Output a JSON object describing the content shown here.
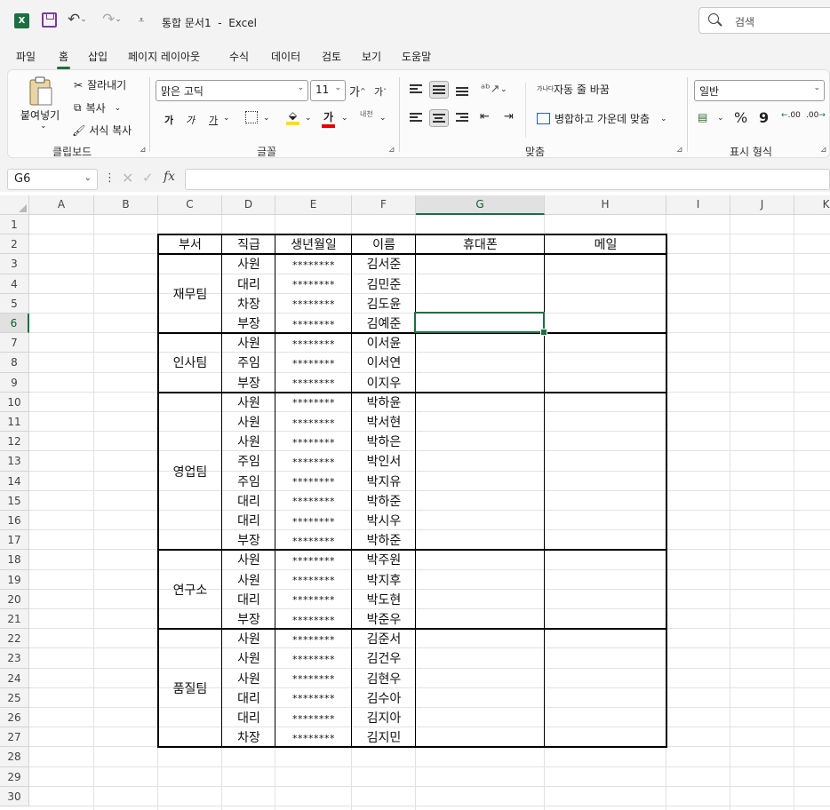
{
  "window": {
    "title": "통합 문서1  -  Excel",
    "app_icon": "X",
    "search_placeholder": "검색"
  },
  "menu": [
    "파일",
    "홈",
    "삽입",
    "페이지 레이아웃",
    "수식",
    "데이터",
    "검토",
    "보기",
    "도움말"
  ],
  "active_menu": "홈",
  "ribbon": {
    "clipboard": {
      "paste": "붙여넣기",
      "cut": "잘라내기",
      "copy": "복사",
      "format_painter": "서식 복사",
      "group": "클립보드"
    },
    "font": {
      "name": "맑은 고딕",
      "size": "11",
      "grow": "가",
      "shrink": "가",
      "bold": "가",
      "italic": "가",
      "underline": "가",
      "font_color_glyph": "가",
      "phonetic": "내천",
      "group": "글꼴"
    },
    "alignment": {
      "wrap_text": "자동 줄 바꿈",
      "merge_center": "병합하고 가운데 맞춤",
      "wrap_icon_text": "가나다",
      "group": "맞춤"
    },
    "number": {
      "format": "일반",
      "percent": "%",
      "comma": "9",
      "increase_decimal": ".00",
      "decrease_decimal": ".00",
      "group": "표시 형식"
    }
  },
  "formula_bar": {
    "name_box": "G6",
    "fx": "fx",
    "value": ""
  },
  "columns": [
    "A",
    "B",
    "C",
    "D",
    "E",
    "F",
    "G",
    "H",
    "I",
    "J",
    "K"
  ],
  "rows": [
    "1",
    "2",
    "3",
    "4",
    "5",
    "6",
    "7",
    "8",
    "9",
    "10",
    "11",
    "12",
    "13",
    "14",
    "15",
    "16",
    "17",
    "18",
    "19",
    "20",
    "21",
    "22",
    "23",
    "24",
    "25",
    "26",
    "27",
    "28",
    "29",
    "30"
  ],
  "selected_cell": {
    "column": "G",
    "row": "6"
  },
  "table": {
    "headers": [
      "부서",
      "직급",
      "생년월일",
      "이름",
      "휴대폰",
      "메일"
    ],
    "departments": [
      {
        "name": "재무팀",
        "rows": [
          [
            "사원",
            "********",
            "김서준"
          ],
          [
            "대리",
            "********",
            "김민준"
          ],
          [
            "차장",
            "********",
            "김도윤"
          ],
          [
            "부장",
            "********",
            "김예준"
          ]
        ]
      },
      {
        "name": "인사팀",
        "rows": [
          [
            "사원",
            "********",
            "이서윤"
          ],
          [
            "주임",
            "********",
            "이서연"
          ],
          [
            "부장",
            "********",
            "이지우"
          ]
        ]
      },
      {
        "name": "영업팀",
        "rows": [
          [
            "사원",
            "********",
            "박하윤"
          ],
          [
            "사원",
            "********",
            "박서현"
          ],
          [
            "사원",
            "********",
            "박하은"
          ],
          [
            "주임",
            "********",
            "박인서"
          ],
          [
            "주임",
            "********",
            "박지유"
          ],
          [
            "대리",
            "********",
            "박하준"
          ],
          [
            "대리",
            "********",
            "박시우"
          ],
          [
            "부장",
            "********",
            "박하준"
          ]
        ]
      },
      {
        "name": "연구소",
        "rows": [
          [
            "사원",
            "********",
            "박주원"
          ],
          [
            "사원",
            "********",
            "박지후"
          ],
          [
            "대리",
            "********",
            "박도현"
          ],
          [
            "부장",
            "********",
            "박준우"
          ]
        ]
      },
      {
        "name": "품질팀",
        "rows": [
          [
            "사원",
            "********",
            "김준서"
          ],
          [
            "사원",
            "********",
            "김건우"
          ],
          [
            "사원",
            "********",
            "김현우"
          ],
          [
            "대리",
            "********",
            "김수아"
          ],
          [
            "대리",
            "********",
            "김지아"
          ],
          [
            "차장",
            "********",
            "김지민"
          ]
        ]
      }
    ]
  }
}
